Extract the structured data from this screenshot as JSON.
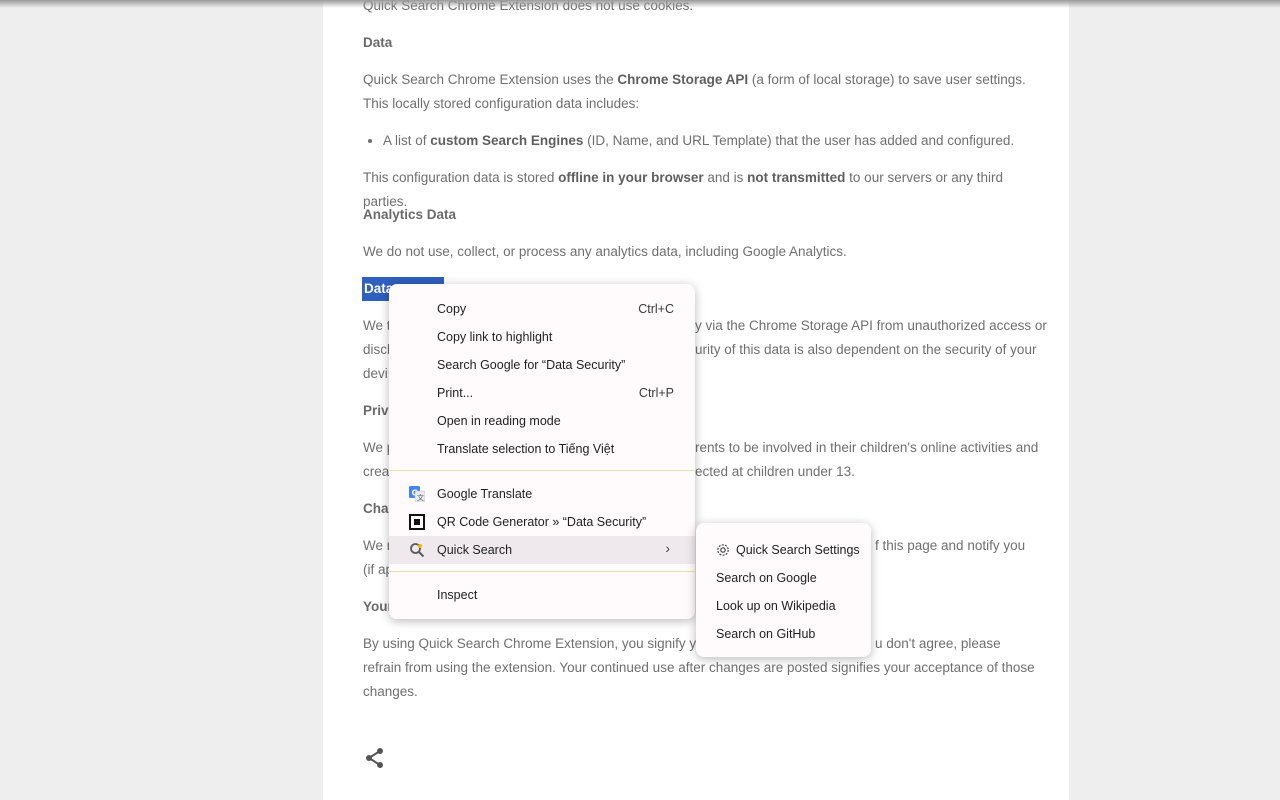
{
  "doc": {
    "intro_line": "Quick Search Chrome Extension does not use cookies.",
    "data_heading": "Data",
    "data_p1_a": "Quick Search Chrome Extension uses the ",
    "data_p1_b": "Chrome Storage API",
    "data_p1_c": " (a form of local storage) to save user settings. This locally stored configuration data includes:",
    "bullet_a": "A list of ",
    "bullet_b": "custom Search Engines",
    "bullet_c": " (ID, Name, and URL Template) that the user has added and configured.",
    "data_p2_a": "This configuration data is stored ",
    "data_p2_b": "offline in your browser",
    "data_p2_c": " and is ",
    "data_p2_d": "not transmitted",
    "data_p2_e": " to our servers or any third parties.",
    "analytics_heading": "Analytics Data",
    "analytics_p": "We do not use, collect, or process any analytics data, including Google Analytics.",
    "security_heading_partial": "Data",
    "security_l1_left": "We t",
    "security_l1_right": "y via the Chrome Storage API from unauthorized access or",
    "security_l2_left": "discl",
    "security_l2_right": "urity of this data is also dependent on the security of your",
    "security_l3_left": "devi",
    "privacy_heading_partial": "Priva",
    "children_l1_left": "We p",
    "children_l1_right": "rents to be involved in their children's online activities and",
    "children_l2_left": "creat",
    "children_l2_right": "ected at children under 13.",
    "changes_heading_partial": "Chan",
    "changes_l1_left": "We r",
    "changes_l1_right": "f this page and notify you",
    "changes_l2_left": "(if ap",
    "your_heading_partial": "Your",
    "consent_l1_left": "By using Quick Search Chrome Extension, you signify your",
    "consent_l1_right": "u don't agree, please",
    "consent_l2": "refrain from using the extension. Your continued use after changes are posted signifies your acceptance of those",
    "consent_l3": "changes."
  },
  "context_menu": {
    "items": [
      {
        "label": "Copy",
        "shortcut": "Ctrl+C"
      },
      {
        "label": "Copy link to highlight",
        "shortcut": ""
      },
      {
        "label": "Search Google for “Data Security”",
        "shortcut": ""
      },
      {
        "label": "Print...",
        "shortcut": "Ctrl+P"
      },
      {
        "label": "Open in reading mode",
        "shortcut": ""
      },
      {
        "label": "Translate selection to Tiếng Việt",
        "shortcut": ""
      },
      {
        "label": "Google Translate",
        "icon": "google-translate-icon"
      },
      {
        "label": "QR Code Generator » “Data Security”",
        "icon": "qr-code-icon"
      },
      {
        "label": "Quick Search",
        "icon": "quick-search-icon"
      },
      {
        "label": "Inspect",
        "shortcut": ""
      }
    ],
    "submenu_arrow": "›"
  },
  "submenu": {
    "items": [
      {
        "label": "Quick Search Settings",
        "icon": "gear-icon"
      },
      {
        "label": "Search on Google"
      },
      {
        "label": "Look up on Wikipedia"
      },
      {
        "label": "Search on GitHub"
      }
    ]
  },
  "colors": {
    "selection": "#2f5fbf",
    "menu_background": "#fffbfd",
    "separator": "#eee2a8"
  }
}
